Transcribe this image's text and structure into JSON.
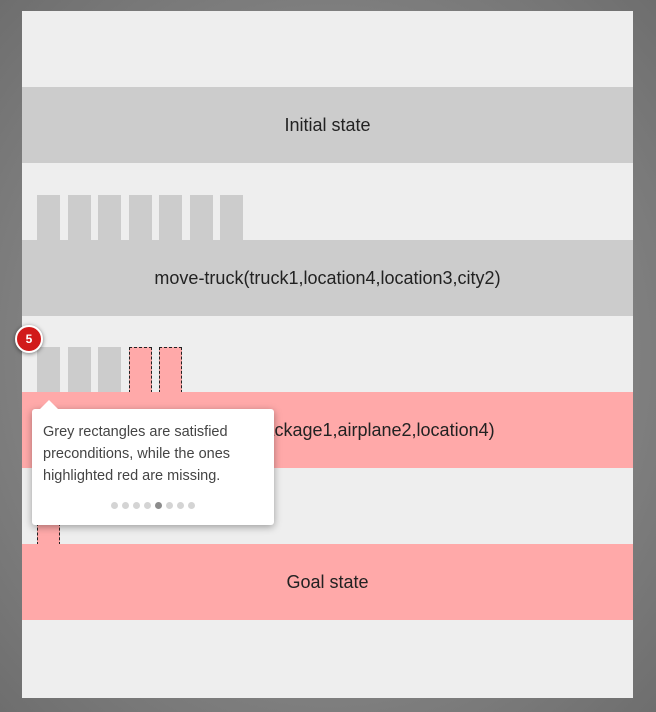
{
  "plan": {
    "initial_state": "Initial state",
    "action1": "move-truck(truck1,location4,location3,city2)",
    "action2": "fly-airplane(package1,airplane2,location4)",
    "goal_state": "Goal state"
  },
  "preconditions": {
    "action1": [
      "satisfied",
      "satisfied",
      "satisfied",
      "satisfied",
      "satisfied",
      "satisfied",
      "satisfied"
    ],
    "action2": [
      "satisfied",
      "satisfied",
      "satisfied",
      "missing",
      "missing"
    ],
    "goal": [
      "missing"
    ]
  },
  "tour": {
    "step_number": "5",
    "tooltip_text": "Grey rectangles are satisfied preconditions, while the ones highlighted red are missing.",
    "total_steps": 8,
    "current_step": 5
  },
  "colors": {
    "satisfied": "#cccccc",
    "missing": "#ffa9a9",
    "badge": "#d11a1a",
    "panel": "#eeeeee"
  }
}
